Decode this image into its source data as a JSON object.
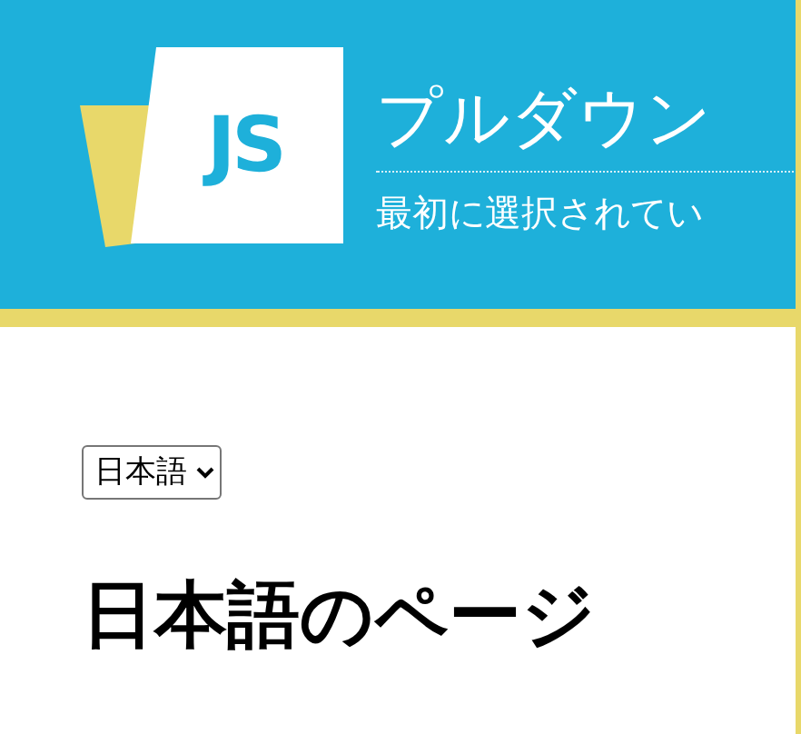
{
  "header": {
    "logo": "JS",
    "title": "プルダウン",
    "subtitle": "最初に選択されてい"
  },
  "language_select": {
    "value": "日本語"
  },
  "heading": "日本語のページ"
}
